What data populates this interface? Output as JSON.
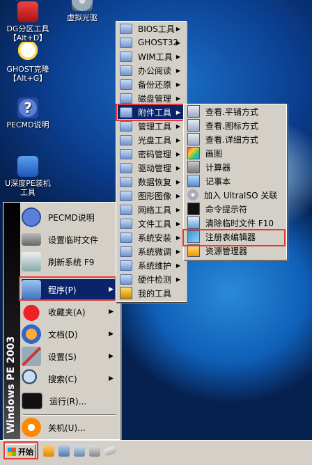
{
  "desktop": {
    "icons": [
      {
        "label_line1": "DG分区工具",
        "label_line2": "【Alt+D】",
        "icon": "dg-partition-icon"
      },
      {
        "label_line1": "虚拟光驱",
        "label_line2": "",
        "icon": "virtual-cd-icon"
      },
      {
        "label_line1": "GHOST克隆",
        "label_line2": "【Alt+G】",
        "icon": "ghost-icon"
      },
      {
        "label_line1": "PECMD说明",
        "label_line2": "",
        "icon": "help-icon"
      },
      {
        "label_line1": "U深度PE装机",
        "label_line2": "工具",
        "icon": "shield-icon"
      }
    ]
  },
  "start_menu": {
    "band_text": "Windows PE 2003",
    "items": [
      {
        "label": "PECMD说明",
        "icon": "help-icon",
        "submenu": false
      },
      {
        "label": "设置临时文件",
        "icon": "memory-icon",
        "submenu": false
      },
      {
        "label": "刷新系统 F9",
        "icon": "refresh-icon",
        "submenu": false
      },
      {
        "label": "程序(P)",
        "icon": "programs-icon",
        "submenu": true
      },
      {
        "label": "收藏夹(A)",
        "icon": "favorites-icon",
        "submenu": true
      },
      {
        "label": "文档(D)",
        "icon": "documents-icon",
        "submenu": true
      },
      {
        "label": "设置(S)",
        "icon": "settings-icon",
        "submenu": true
      },
      {
        "label": "搜索(C)",
        "icon": "search-icon",
        "submenu": true
      },
      {
        "label": "运行(R)...",
        "icon": "run-icon",
        "submenu": false
      },
      {
        "label": "关机(U)...",
        "icon": "shutdown-icon",
        "submenu": false
      }
    ]
  },
  "programs_menu": {
    "items": [
      {
        "label": "BIOS工具",
        "submenu": true
      },
      {
        "label": "GHOST32",
        "submenu": true
      },
      {
        "label": "WIM工具",
        "submenu": true
      },
      {
        "label": "办公阅读",
        "submenu": true
      },
      {
        "label": "备份还原",
        "submenu": true
      },
      {
        "label": "磁盘管理",
        "submenu": true
      },
      {
        "label": "附件工具",
        "submenu": true
      },
      {
        "label": "管理工具",
        "submenu": true
      },
      {
        "label": "光盘工具",
        "submenu": true
      },
      {
        "label": "密码管理",
        "submenu": true
      },
      {
        "label": "驱动管理",
        "submenu": true
      },
      {
        "label": "数据恢复",
        "submenu": true
      },
      {
        "label": "图形图像",
        "submenu": true
      },
      {
        "label": "网络工具",
        "submenu": true
      },
      {
        "label": "文件工具",
        "submenu": true
      },
      {
        "label": "系统安装",
        "submenu": true
      },
      {
        "label": "系统微调",
        "submenu": true
      },
      {
        "label": "系统维护",
        "submenu": true
      },
      {
        "label": "硬件检测",
        "submenu": true
      },
      {
        "label": "我的工具",
        "submenu": false
      }
    ]
  },
  "accessories_menu": {
    "items": [
      {
        "label": "查看.平铺方式",
        "icon": "view-tile-icon"
      },
      {
        "label": "查看.图标方式",
        "icon": "view-icons-icon"
      },
      {
        "label": "查看.详细方式",
        "icon": "view-details-icon"
      },
      {
        "label": "画图",
        "icon": "paint-icon"
      },
      {
        "label": "计算器",
        "icon": "calculator-icon"
      },
      {
        "label": "记事本",
        "icon": "notepad-icon"
      },
      {
        "label": "加入 UltraISO 关联",
        "icon": "ultraiso-icon"
      },
      {
        "label": "命令提示符",
        "icon": "cmd-icon"
      },
      {
        "label": "清除临时文件 F10",
        "icon": "clean-icon"
      },
      {
        "label": "注册表编辑器",
        "icon": "regedit-icon"
      },
      {
        "label": "资源管理器",
        "icon": "explorer-icon"
      }
    ]
  },
  "taskbar": {
    "start_label": "开始"
  },
  "colors": {
    "highlight": "#0a246a",
    "menu_bg": "#d4d0c8",
    "annotation_red": "#e23a3a"
  }
}
